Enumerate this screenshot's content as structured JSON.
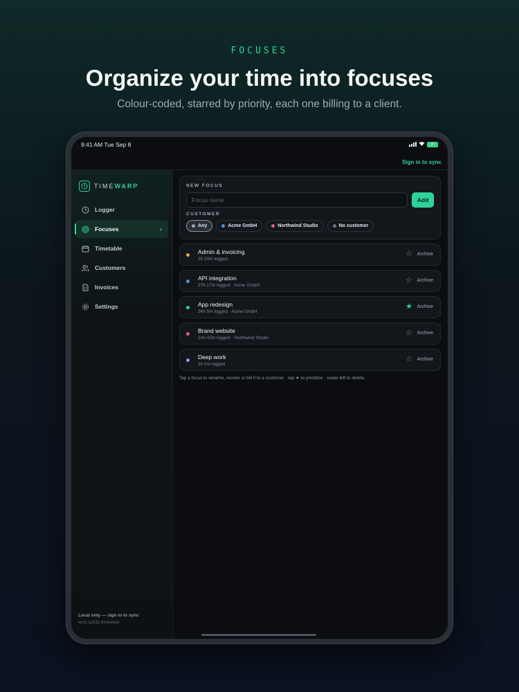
{
  "hero": {
    "eyebrow": "FOCUSES",
    "headline": "Organize your time into focuses",
    "subhead": "Colour-coded, starred by priority, each one billing to a client."
  },
  "status_bar": {
    "time": "9:41 AM  Tue Sep 8",
    "battery_icon": "battery-icon",
    "signal_icon": "signal-icon",
    "wifi_icon": "wifi-icon"
  },
  "sync": {
    "label": "Sign in to sync"
  },
  "brand": {
    "prefix": "TIME",
    "suffix": "WARP",
    "icon": "clock-icon"
  },
  "nav": {
    "items": [
      {
        "label": "Logger",
        "icon": "clock-icon",
        "active": false
      },
      {
        "label": "Focuses",
        "icon": "target-icon",
        "active": true
      },
      {
        "label": "Timetable",
        "icon": "calendar-icon",
        "active": false
      },
      {
        "label": "Customers",
        "icon": "users-icon",
        "active": false
      },
      {
        "label": "Invoices",
        "icon": "document-icon",
        "active": false
      },
      {
        "label": "Settings",
        "icon": "gear-icon",
        "active": false
      }
    ]
  },
  "sidebar_footer": {
    "line1": "Local only — sign in to sync",
    "line2": "tech.sp33c.timewarp"
  },
  "new_focus": {
    "section_label": "NEW FOCUS",
    "input_placeholder": "Focus name",
    "input_value": "",
    "add_label": "Add",
    "customer_label": "CUSTOMER",
    "chips": [
      {
        "label": "Any",
        "color": "#9aa4ac",
        "selected": true
      },
      {
        "label": "Acme GmbH",
        "color": "#4a9ae8",
        "selected": false
      },
      {
        "label": "Northwind Studio",
        "color": "#e85a8a",
        "selected": false
      },
      {
        "label": "No customer",
        "color": "#6c757d",
        "selected": false
      }
    ]
  },
  "focuses": [
    {
      "name": "Admin & invoicing",
      "meta": "3h 20m logged",
      "color": "#f0a048",
      "starred": false,
      "archive_label": "Archive"
    },
    {
      "name": "API integration",
      "meta": "27h 17m logged · Acme GmbH",
      "color": "#4a9ae8",
      "starred": false,
      "archive_label": "Archive"
    },
    {
      "name": "App redesign",
      "meta": "36h 5m logged · Acme GmbH",
      "color": "#2fd39a",
      "starred": true,
      "archive_label": "Archive"
    },
    {
      "name": "Brand website",
      "meta": "10h 42m logged · Northwind Studio",
      "color": "#e85a8a",
      "starred": false,
      "archive_label": "Archive"
    },
    {
      "name": "Deep work",
      "meta": "2h 0m logged",
      "color": "#b08ee8",
      "starred": false,
      "archive_label": "Archive"
    }
  ],
  "hint": "Tap a focus to rename, recolor or bill it to a customer · tap ★ to prioritize · swipe left to delete.",
  "colors": {
    "accent": "#2fd39a",
    "background": "#0b0d10"
  }
}
